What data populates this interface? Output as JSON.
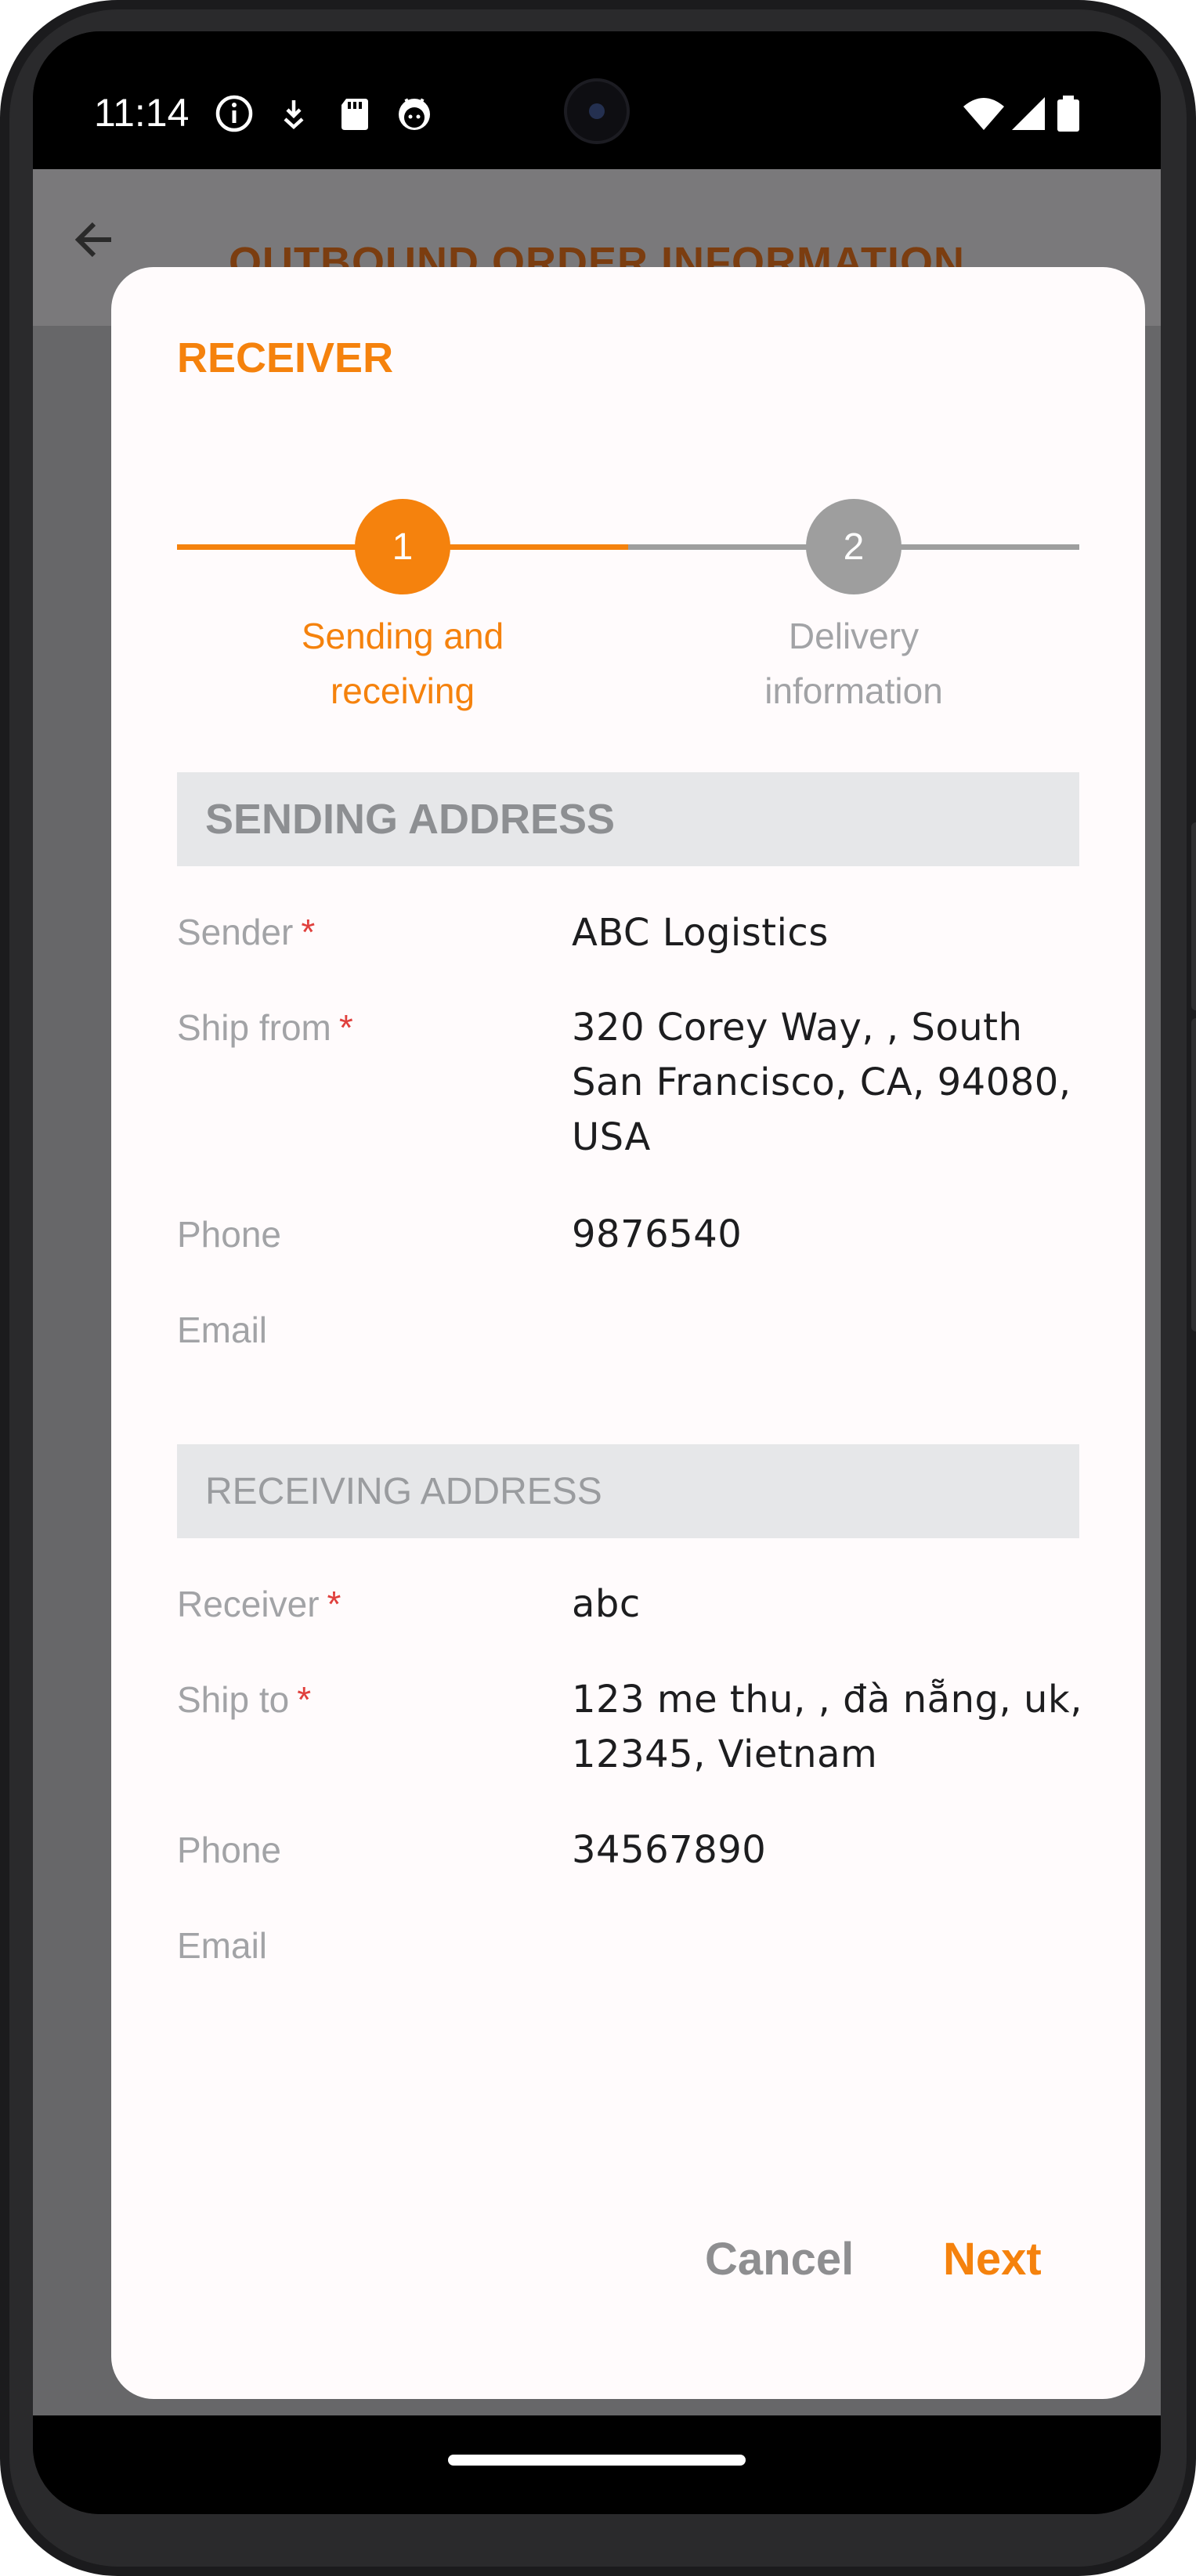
{
  "status_bar": {
    "time": "11:14",
    "icons": [
      "info-icon",
      "download-icon",
      "sd-card-icon",
      "android-icon"
    ],
    "right_icons": [
      "wifi-icon",
      "signal-icon",
      "battery-icon"
    ]
  },
  "app": {
    "title": "OUTBOUND ORDER INFORMATION"
  },
  "dialog": {
    "title": "RECEIVER",
    "steps": [
      {
        "number": "1",
        "label_line1": "Sending and",
        "label_line2": "receiving",
        "active": true
      },
      {
        "number": "2",
        "label_line1": "Delivery",
        "label_line2": "information",
        "active": false
      }
    ],
    "sending": {
      "header": "SENDING ADDRESS",
      "fields": [
        {
          "label": "Sender",
          "required": "*",
          "value": "ABC Logistics"
        },
        {
          "label": "Ship from",
          "required": "*",
          "value_lines": [
            "320 Corey Way, , South",
            "San Francisco, CA, 94080,",
            "USA"
          ]
        },
        {
          "label": "Phone",
          "value": "9876540"
        },
        {
          "label": "Email",
          "value": ""
        }
      ]
    },
    "receiving": {
      "header": "RECEIVING ADDRESS",
      "fields": [
        {
          "label": "Receiver",
          "required": "*",
          "value": "abc"
        },
        {
          "label": "Ship to",
          "required": "*",
          "value_lines": [
            "123 me thu, , đà nẵng, uk,",
            "12345, Vietnam"
          ]
        },
        {
          "label": "Phone",
          "value": "34567890"
        },
        {
          "label": "Email",
          "value": ""
        }
      ]
    },
    "buttons": {
      "cancel": "Cancel",
      "next": "Next"
    }
  },
  "colors": {
    "accent": "#f5820d",
    "inactive": "#9e9e9e",
    "required": "#e0403d",
    "label": "#a2a3a6",
    "value": "#1d1d1f",
    "section_bg": "#e6e7e9"
  }
}
